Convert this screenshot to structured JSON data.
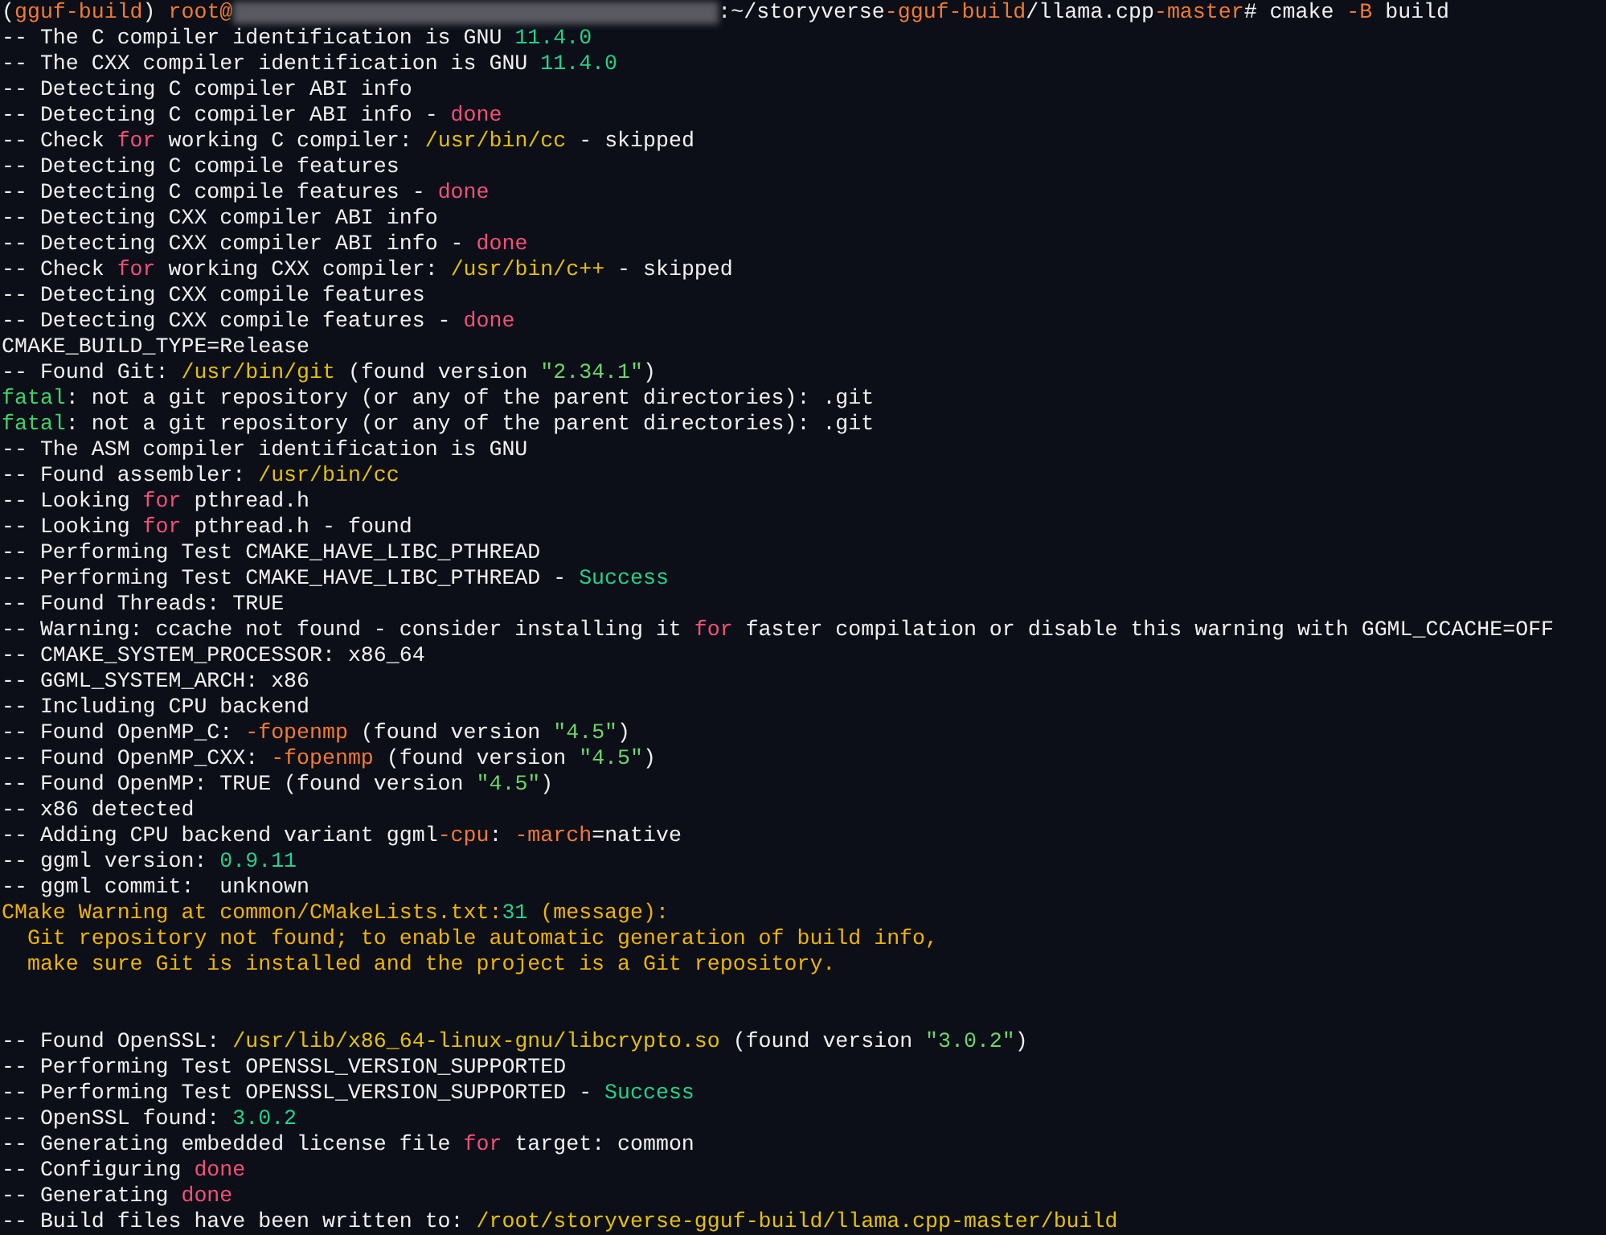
{
  "terminal": {
    "lines": [
      {
        "kind": "prompt",
        "parts": [
          {
            "kind": "text",
            "segments": [
              {
                "text": "("
              },
              {
                "text": "gguf-build",
                "color": "#f07a35"
              },
              {
                "text": ") "
              },
              {
                "text": "root@",
                "color": "#f07a35"
              }
            ]
          },
          {
            "kind": "redacted"
          },
          {
            "kind": "text",
            "segments": [
              {
                "text": ":~/storyverse"
              },
              {
                "text": "-gguf-build",
                "color": "#f07a35"
              },
              {
                "text": "/llama.cpp"
              },
              {
                "text": "-master",
                "color": "#f07a35"
              },
              {
                "text": "# cmake "
              },
              {
                "text": "-B",
                "color": "#f07a35"
              },
              {
                "text": " build"
              }
            ]
          }
        ]
      },
      {
        "segments": [
          {
            "text": "-- The C compiler identification is GNU "
          },
          {
            "text": "11.4.0",
            "color": "#23d18b"
          }
        ]
      },
      {
        "segments": [
          {
            "text": "-- The CXX compiler identification is GNU "
          },
          {
            "text": "11.4.0",
            "color": "#23d18b"
          }
        ]
      },
      {
        "segments": [
          {
            "text": "-- Detecting C compiler ABI info"
          }
        ]
      },
      {
        "segments": [
          {
            "text": "-- Detecting C compiler ABI info - "
          },
          {
            "text": "done",
            "color": "#f2507a"
          }
        ]
      },
      {
        "segments": [
          {
            "text": "-- Check "
          },
          {
            "text": "for",
            "color": "#f2507a"
          },
          {
            "text": " working C compiler: "
          },
          {
            "text": "/usr/bin/cc",
            "color": "#e5c007"
          },
          {
            "text": " - skipped"
          }
        ]
      },
      {
        "segments": [
          {
            "text": "-- Detecting C compile features"
          }
        ]
      },
      {
        "segments": [
          {
            "text": "-- Detecting C compile features - "
          },
          {
            "text": "done",
            "color": "#f2507a"
          }
        ]
      },
      {
        "segments": [
          {
            "text": "-- Detecting CXX compiler ABI info"
          }
        ]
      },
      {
        "segments": [
          {
            "text": "-- Detecting CXX compiler ABI info - "
          },
          {
            "text": "done",
            "color": "#f2507a"
          }
        ]
      },
      {
        "segments": [
          {
            "text": "-- Check "
          },
          {
            "text": "for",
            "color": "#f2507a"
          },
          {
            "text": " working CXX compiler: "
          },
          {
            "text": "/usr/bin/c++",
            "color": "#e5c007"
          },
          {
            "text": " - skipped"
          }
        ]
      },
      {
        "segments": [
          {
            "text": "-- Detecting CXX compile features"
          }
        ]
      },
      {
        "segments": [
          {
            "text": "-- Detecting CXX compile features - "
          },
          {
            "text": "done",
            "color": "#f2507a"
          }
        ]
      },
      {
        "segments": [
          {
            "text": "CMAKE_BUILD_TYPE=Release"
          }
        ]
      },
      {
        "segments": [
          {
            "text": "-- Found Git: "
          },
          {
            "text": "/usr/bin/git",
            "color": "#e5c007"
          },
          {
            "text": " (found version "
          },
          {
            "text": "\"2.34.1\"",
            "color": "#6ed36b"
          },
          {
            "text": ")"
          }
        ]
      },
      {
        "segments": [
          {
            "text": "fatal",
            "color": "#3fd36b"
          },
          {
            "text": ": not a git repository (or any of the parent directories): .git"
          }
        ]
      },
      {
        "segments": [
          {
            "text": "fatal",
            "color": "#3fd36b"
          },
          {
            "text": ": not a git repository (or any of the parent directories): .git"
          }
        ]
      },
      {
        "segments": [
          {
            "text": "-- The ASM compiler identification is GNU"
          }
        ]
      },
      {
        "segments": [
          {
            "text": "-- Found assembler: "
          },
          {
            "text": "/usr/bin/cc",
            "color": "#e5c007"
          }
        ]
      },
      {
        "segments": [
          {
            "text": "-- Looking "
          },
          {
            "text": "for",
            "color": "#f2507a"
          },
          {
            "text": " pthread.h"
          }
        ]
      },
      {
        "segments": [
          {
            "text": "-- Looking "
          },
          {
            "text": "for",
            "color": "#f2507a"
          },
          {
            "text": " pthread.h - found"
          }
        ]
      },
      {
        "segments": [
          {
            "text": "-- Performing Test CMAKE_HAVE_LIBC_PTHREAD"
          }
        ]
      },
      {
        "segments": [
          {
            "text": "-- Performing Test CMAKE_HAVE_LIBC_PTHREAD - "
          },
          {
            "text": "Success",
            "color": "#23d18b"
          }
        ]
      },
      {
        "segments": [
          {
            "text": "-- Found Threads: TRUE"
          }
        ]
      },
      {
        "segments": [
          {
            "text": "-- Warning: ccache not found - consider installing it "
          },
          {
            "text": "for",
            "color": "#f2507a"
          },
          {
            "text": " faster compilation or disable this warning with GGML_CCACHE=OFF"
          }
        ]
      },
      {
        "segments": [
          {
            "text": "-- CMAKE_SYSTEM_PROCESSOR: x86_64"
          }
        ]
      },
      {
        "segments": [
          {
            "text": "-- GGML_SYSTEM_ARCH: x86"
          }
        ]
      },
      {
        "segments": [
          {
            "text": "-- Including CPU backend"
          }
        ]
      },
      {
        "segments": [
          {
            "text": "-- Found OpenMP_C: "
          },
          {
            "text": "-fopenmp",
            "color": "#f07a35"
          },
          {
            "text": " (found version "
          },
          {
            "text": "\"4.5\"",
            "color": "#6ed36b"
          },
          {
            "text": ")"
          }
        ]
      },
      {
        "segments": [
          {
            "text": "-- Found OpenMP_CXX: "
          },
          {
            "text": "-fopenmp",
            "color": "#f07a35"
          },
          {
            "text": " (found version "
          },
          {
            "text": "\"4.5\"",
            "color": "#6ed36b"
          },
          {
            "text": ")"
          }
        ]
      },
      {
        "segments": [
          {
            "text": "-- Found OpenMP: TRUE (found version "
          },
          {
            "text": "\"4.5\"",
            "color": "#6ed36b"
          },
          {
            "text": ")"
          }
        ]
      },
      {
        "segments": [
          {
            "text": "-- x86 detected"
          }
        ]
      },
      {
        "segments": [
          {
            "text": "-- Adding CPU backend variant ggml"
          },
          {
            "text": "-cpu",
            "color": "#f07a35"
          },
          {
            "text": ": "
          },
          {
            "text": "-march",
            "color": "#f07a35"
          },
          {
            "text": "=native"
          }
        ]
      },
      {
        "segments": [
          {
            "text": "-- ggml version: "
          },
          {
            "text": "0.9.11",
            "color": "#23d18b"
          }
        ]
      },
      {
        "segments": [
          {
            "text": "-- ggml commit:  unknown"
          }
        ]
      },
      {
        "segments": [
          {
            "text": "CMake Warning at common/CMakeLists.txt:",
            "color": "#f0b400"
          },
          {
            "text": "31",
            "color": "#23d18b"
          },
          {
            "text": " (message):",
            "color": "#f0b400"
          }
        ]
      },
      {
        "segments": [
          {
            "text": "  Git repository not found; to enable automatic generation of build info,",
            "color": "#f0b400"
          }
        ]
      },
      {
        "segments": [
          {
            "text": "  make sure Git is installed and the project is a Git repository.",
            "color": "#f0b400"
          }
        ]
      },
      {
        "kind": "blank"
      },
      {
        "kind": "blank"
      },
      {
        "segments": [
          {
            "text": "-- Found OpenSSL: "
          },
          {
            "text": "/usr/lib/x86_64-linux-gnu/libcrypto.so",
            "color": "#e5c007"
          },
          {
            "text": " (found version "
          },
          {
            "text": "\"3.0.2\"",
            "color": "#6ed36b"
          },
          {
            "text": ")"
          }
        ]
      },
      {
        "segments": [
          {
            "text": "-- Performing Test OPENSSL_VERSION_SUPPORTED"
          }
        ]
      },
      {
        "segments": [
          {
            "text": "-- Performing Test OPENSSL_VERSION_SUPPORTED - "
          },
          {
            "text": "Success",
            "color": "#23d18b"
          }
        ]
      },
      {
        "segments": [
          {
            "text": "-- OpenSSL found: "
          },
          {
            "text": "3.0.2",
            "color": "#23d18b"
          }
        ]
      },
      {
        "segments": [
          {
            "text": "-- Generating embedded license file "
          },
          {
            "text": "for",
            "color": "#f2507a"
          },
          {
            "text": " target: common"
          }
        ]
      },
      {
        "segments": [
          {
            "text": "-- Configuring "
          },
          {
            "text": "done",
            "color": "#f2507a"
          }
        ]
      },
      {
        "segments": [
          {
            "text": "-- Generating "
          },
          {
            "text": "done",
            "color": "#f2507a"
          }
        ]
      },
      {
        "segments": [
          {
            "text": "-- Build files have been written to: "
          },
          {
            "text": "/root/storyverse-gguf-build/llama.cpp-master/build",
            "color": "#e5c007"
          }
        ]
      }
    ]
  }
}
